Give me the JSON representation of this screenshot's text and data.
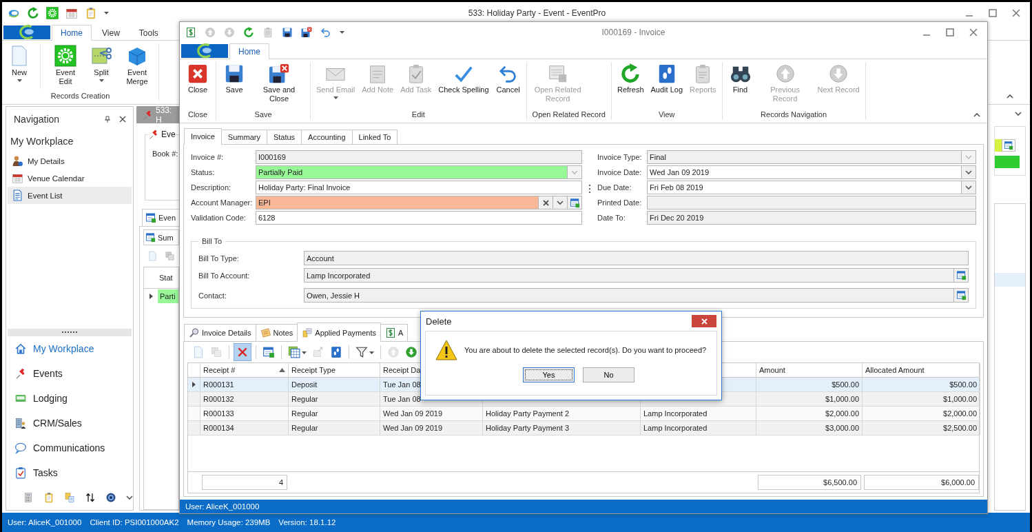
{
  "main_window": {
    "title": "533: Holiday Party - Event - EventPro",
    "ribbon_tabs": [
      {
        "label": "Home",
        "selected": true
      },
      {
        "label": "View",
        "selected": false
      },
      {
        "label": "Tools",
        "selected": false
      }
    ],
    "ribbon_groups": [
      {
        "label": "Records Creation",
        "buttons": [
          {
            "label": "New",
            "dropdown": true
          },
          {
            "label": "Event Edit",
            "dropdown": false
          },
          {
            "label": "Split",
            "dropdown": true
          },
          {
            "label": "Event Merge",
            "dropdown": false
          }
        ]
      }
    ]
  },
  "navigation": {
    "title": "Navigation",
    "heading": "My Workplace",
    "items": [
      {
        "label": "My Details",
        "selected": false
      },
      {
        "label": "Venue Calendar",
        "selected": false
      },
      {
        "label": "Event List",
        "selected": true
      }
    ],
    "modules": [
      {
        "label": "My Workplace",
        "selected": true
      },
      {
        "label": "Events",
        "selected": false
      },
      {
        "label": "Lodging",
        "selected": false
      },
      {
        "label": "CRM/Sales",
        "selected": false
      },
      {
        "label": "Communications",
        "selected": false
      },
      {
        "label": "Tasks",
        "selected": false
      }
    ]
  },
  "background_document": {
    "tab": "533: H",
    "group": "Eve",
    "field_label": "Book #:",
    "document_tab": "Even",
    "sub_tab": "Sum",
    "column": "Stat",
    "cell": "Parti"
  },
  "status_bar": [
    "User: AliceK_001000",
    "Client ID: PSI001000AK2",
    "Memory Usage: 239MB",
    "Version: 18.1.12"
  ],
  "invoice_window": {
    "title": "I000169 - Invoice",
    "ribbon_tabs": [
      {
        "label": "Home",
        "selected": true
      }
    ],
    "ribbon_groups": [
      {
        "label": "Close",
        "buttons": [
          {
            "label": "Close",
            "disabled": false,
            "dropdown": false
          }
        ]
      },
      {
        "label": "Save",
        "buttons": [
          {
            "label": "Save",
            "disabled": false,
            "dropdown": false
          },
          {
            "label": "Save and Close",
            "disabled": false,
            "dropdown": false
          }
        ]
      },
      {
        "label": "Edit",
        "buttons": [
          {
            "label": "Send Email",
            "disabled": true,
            "dropdown": true
          },
          {
            "label": "Add Note",
            "disabled": true,
            "dropdown": false
          },
          {
            "label": "Add Task",
            "disabled": true,
            "dropdown": false
          },
          {
            "label": "Check Spelling",
            "disabled": false,
            "dropdown": false
          },
          {
            "label": "Cancel",
            "disabled": false,
            "dropdown": false
          }
        ]
      },
      {
        "label": "Open Related Record",
        "buttons": [
          {
            "label": "Open Related Record",
            "disabled": true,
            "dropdown": false
          }
        ]
      },
      {
        "label": "View",
        "buttons": [
          {
            "label": "Refresh",
            "disabled": false,
            "dropdown": false
          },
          {
            "label": "Audit Log",
            "disabled": false,
            "dropdown": false
          },
          {
            "label": "Reports",
            "disabled": true,
            "dropdown": false
          }
        ]
      },
      {
        "label": "Records Navigation",
        "buttons": [
          {
            "label": "Find",
            "disabled": false,
            "dropdown": false
          },
          {
            "label": "Previous Record",
            "disabled": true,
            "dropdown": false
          },
          {
            "label": "Next Record",
            "disabled": true,
            "dropdown": false
          }
        ]
      }
    ],
    "tabs": [
      {
        "label": "Invoice",
        "selected": true
      },
      {
        "label": "Summary",
        "selected": false
      },
      {
        "label": "Status",
        "selected": false
      },
      {
        "label": "Accounting",
        "selected": false
      },
      {
        "label": "Linked To",
        "selected": false
      }
    ],
    "fields_left": [
      {
        "label": "Invoice #:",
        "value": "I000169",
        "kind": "text",
        "readonly": true
      },
      {
        "label": "Status:",
        "value": "Partially Paid",
        "kind": "combo",
        "readonly": true,
        "color": "#98f898"
      },
      {
        "label": "Description:",
        "value": "Holiday Party: Final Invoice",
        "kind": "text",
        "readonly": false
      },
      {
        "label": "Account Manager:",
        "value": "EPI",
        "kind": "combo_lookup",
        "color": "#f8b898"
      },
      {
        "label": "Validation Code:",
        "value": "6128",
        "kind": "text",
        "readonly": false
      }
    ],
    "fields_right": [
      {
        "label": "Invoice Type:",
        "value": "Final",
        "kind": "combo",
        "readonly": true
      },
      {
        "label": "Invoice Date:",
        "value": "Wed Jan 09 2019",
        "kind": "combo",
        "readonly": false
      },
      {
        "label": "Due Date:",
        "value": "Fri Feb 08 2019",
        "kind": "combo",
        "readonly": false
      },
      {
        "label": "Printed Date:",
        "kind": "text",
        "readonly": true
      },
      {
        "label": "Date To:",
        "value": "Fri Dec 20 2019",
        "kind": "text",
        "readonly": true
      }
    ],
    "bill_to": {
      "title": "Bill To",
      "fields": [
        {
          "label": "Bill To Type:",
          "value": "Account",
          "kind": "text",
          "readonly": true
        },
        {
          "label": "Bill To Account:",
          "value": "Lamp Incorporated",
          "kind": "lookup",
          "readonly": true
        },
        {
          "label": "Contact:",
          "value": "Owen, Jessie H",
          "kind": "lookup",
          "readonly": true
        }
      ]
    },
    "detail_tabs": [
      {
        "label": "Invoice Details",
        "selected": false
      },
      {
        "label": "Notes",
        "selected": false
      },
      {
        "label": "Applied Payments",
        "selected": true
      },
      {
        "label": "A",
        "selected": false
      }
    ],
    "toolbar": [
      {
        "pressed": false,
        "disabled": false,
        "dropdown": false
      },
      {
        "pressed": false,
        "disabled": true,
        "dropdown": false
      },
      {
        "pressed": true,
        "disabled": false,
        "dropdown": false
      },
      {
        "pressed": false,
        "disabled": false,
        "dropdown": false
      },
      {
        "pressed": false,
        "disabled": false,
        "dropdown": true
      },
      {
        "pressed": false,
        "disabled": true,
        "dropdown": false
      },
      {
        "pressed": false,
        "disabled": false,
        "dropdown": false
      },
      {
        "pressed": false,
        "disabled": false,
        "dropdown": true
      },
      {
        "pressed": false,
        "disabled": true,
        "dropdown": false
      },
      {
        "pressed": false,
        "disabled": false,
        "dropdown": false
      }
    ],
    "grid": {
      "columns": [
        {
          "label": "Receipt #",
          "sorted": true
        },
        {
          "label": "Receipt Type",
          "sorted": false
        },
        {
          "label": "Receipt Da",
          "sorted": false
        },
        null,
        null,
        {
          "label": "Amount",
          "sorted": false
        },
        {
          "label": "Allocated Amount",
          "sorted": false
        }
      ],
      "rows": [
        {
          "selected": true,
          "cells": [
            "R000131",
            "Deposit",
            "Tue Jan 08",
            null,
            null,
            "$500.00",
            "$500.00"
          ]
        },
        {
          "selected": false,
          "cells": [
            "R000132",
            "Regular",
            "Tue Jan 08",
            null,
            null,
            "$1,000.00",
            "$1,000.00"
          ]
        },
        {
          "selected": false,
          "cells": [
            "R000133",
            "Regular",
            "Wed Jan 09 2019",
            "Holiday Party Payment 2",
            "Lamp Incorporated",
            "$2,000.00",
            "$2,000.00"
          ]
        },
        {
          "selected": false,
          "cells": [
            "R000134",
            "Regular",
            "Wed Jan 09 2019",
            "Holiday Party Payment 3",
            "Lamp Incorporated",
            "$3,000.00",
            "$2,500.00"
          ]
        }
      ],
      "footer": {
        "count": "4",
        "amount_total": "$6,500.00",
        "allocated_total": "$6,000.00"
      }
    },
    "status_bar": "User: AliceK_001000"
  },
  "dialog": {
    "title": "Delete",
    "message": "You are about to delete the selected record(s). Do you want to proceed?",
    "buttons": [
      {
        "label": "Yes",
        "selected": true
      },
      {
        "label": "No",
        "selected": false
      }
    ]
  }
}
